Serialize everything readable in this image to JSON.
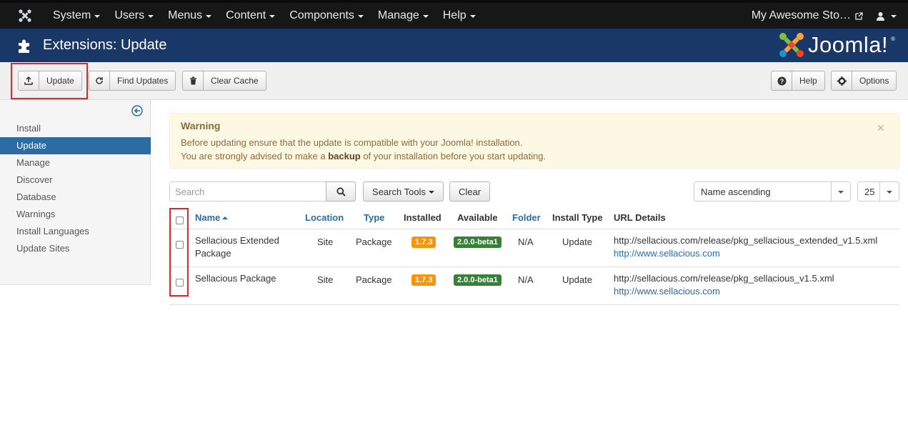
{
  "topbar": {
    "menu": [
      {
        "label": "System"
      },
      {
        "label": "Users"
      },
      {
        "label": "Menus"
      },
      {
        "label": "Content"
      },
      {
        "label": "Components"
      },
      {
        "label": "Manage"
      },
      {
        "label": "Help"
      }
    ],
    "site_name": "My Awesome Sto…"
  },
  "header": {
    "title": "Extensions: Update",
    "logo_text": "Joomla!",
    "logo_reg": "®"
  },
  "toolbar": {
    "update_label": "Update",
    "find_updates_label": "Find Updates",
    "clear_cache_label": "Clear Cache",
    "help_label": "Help",
    "options_label": "Options"
  },
  "sidebar": {
    "items": [
      {
        "label": "Install",
        "active": false
      },
      {
        "label": "Update",
        "active": true
      },
      {
        "label": "Manage",
        "active": false
      },
      {
        "label": "Discover",
        "active": false
      },
      {
        "label": "Database",
        "active": false
      },
      {
        "label": "Warnings",
        "active": false
      },
      {
        "label": "Install Languages",
        "active": false
      },
      {
        "label": "Update Sites",
        "active": false
      }
    ]
  },
  "alert": {
    "title": "Warning",
    "line1": "Before updating ensure that the update is compatible with your Joomla! installation.",
    "line2_pre": "You are strongly advised to make a ",
    "line2_bold": "backup",
    "line2_post": " of your installation before you start updating.",
    "close": "×"
  },
  "filters": {
    "search_placeholder": "Search",
    "search_tools_label": "Search Tools",
    "clear_label": "Clear",
    "sort_value": "Name ascending",
    "limit_value": "25"
  },
  "table": {
    "headers": {
      "name": "Name",
      "location": "Location",
      "type": "Type",
      "installed": "Installed",
      "available": "Available",
      "folder": "Folder",
      "install_type": "Install Type",
      "url_details": "URL Details"
    },
    "rows": [
      {
        "name_line1": "Sellacious Extended",
        "name_line2": "Package",
        "location": "Site",
        "type": "Package",
        "installed": "1.7.3",
        "available": "2.0.0-beta1",
        "folder": "N/A",
        "install_type": "Update",
        "url": "http://sellacious.com/release/pkg_sellacious_extended_v1.5.xml",
        "info_url": "http://www.sellacious.com"
      },
      {
        "name_line1": "Sellacious Package",
        "name_line2": "",
        "location": "Site",
        "type": "Package",
        "installed": "1.7.3",
        "available": "2.0.0-beta1",
        "folder": "N/A",
        "install_type": "Update",
        "url": "http://sellacious.com/release/pkg_sellacious_v1.5.xml",
        "info_url": "http://www.sellacious.com"
      }
    ]
  },
  "colors": {
    "header_bg": "#1a3867",
    "topbar_bg": "#171717",
    "active_sidebar": "#2d6ca2",
    "highlight": "#e2232a",
    "badge_installed": "#f89406",
    "badge_available": "#378137"
  }
}
